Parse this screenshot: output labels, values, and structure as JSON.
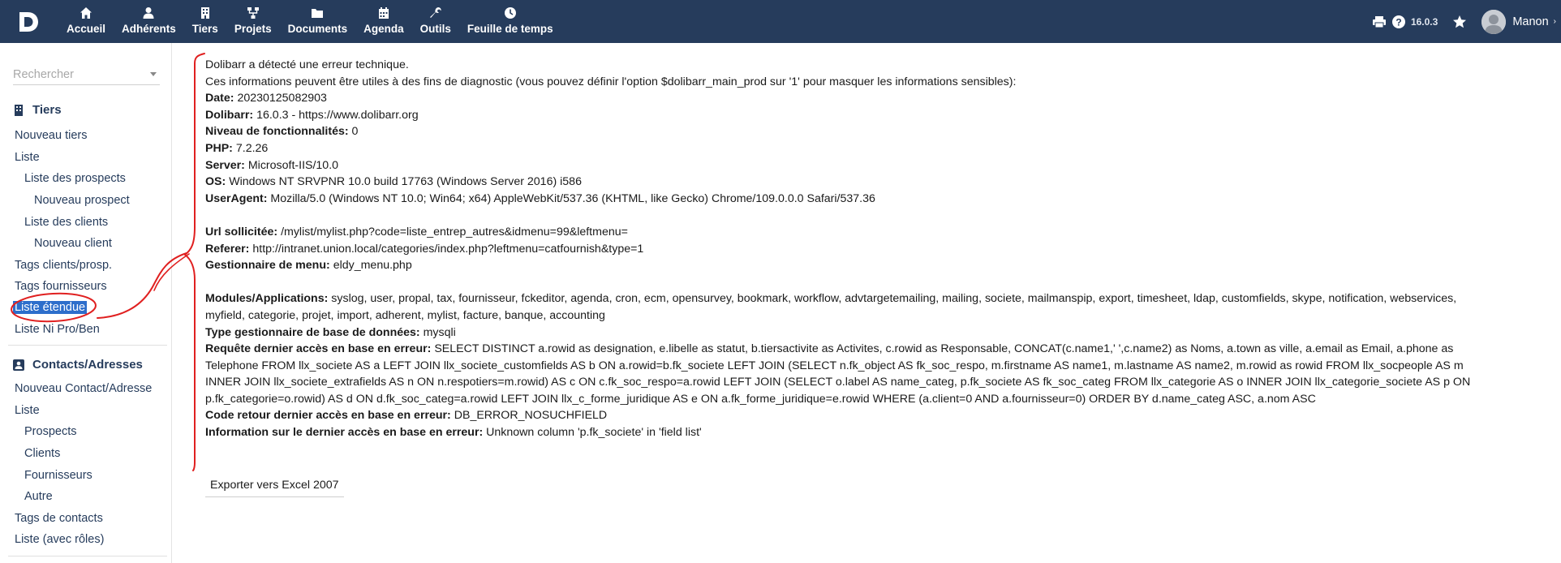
{
  "topbar": {
    "nav": [
      {
        "label": "Accueil",
        "icon": "home-icon"
      },
      {
        "label": "Adhérents",
        "icon": "user-icon"
      },
      {
        "label": "Tiers",
        "icon": "building-icon"
      },
      {
        "label": "Projets",
        "icon": "sitemap-icon"
      },
      {
        "label": "Documents",
        "icon": "folder-icon"
      },
      {
        "label": "Agenda",
        "icon": "calendar-icon"
      },
      {
        "label": "Outils",
        "icon": "wrench-icon"
      },
      {
        "label": "Feuille de temps",
        "icon": "timesheet-icon"
      }
    ],
    "active": "Tiers",
    "version": "16.0.3",
    "username": "Manon",
    "bar_color": "#263c5c"
  },
  "sidebar": {
    "search_placeholder": "Rechercher",
    "tiers_title": "Tiers",
    "tiers_items": [
      {
        "label": "Nouveau tiers"
      },
      {
        "label": "Liste"
      },
      {
        "label": "Liste des prospects"
      },
      {
        "label": "Nouveau prospect"
      },
      {
        "label": "Liste des clients"
      },
      {
        "label": "Nouveau client"
      },
      {
        "label": "Tags clients/prosp."
      },
      {
        "label": "Tags fournisseurs"
      },
      {
        "label": "Liste étendue"
      },
      {
        "label": "Liste Ni Pro/Ben"
      }
    ],
    "contacts_title": "Contacts/Adresses",
    "contacts_items": [
      {
        "label": "Nouveau Contact/Adresse"
      },
      {
        "label": "Liste"
      },
      {
        "label": "Prospects"
      },
      {
        "label": "Clients"
      },
      {
        "label": "Fournisseurs"
      },
      {
        "label": "Autre"
      },
      {
        "label": "Tags de contacts"
      },
      {
        "label": "Liste (avec rôles)"
      }
    ],
    "selected_color": "#2d6ecb"
  },
  "error": {
    "intro1": "Dolibarr a détecté une erreur technique.",
    "intro2": "Ces informations peuvent être utiles à des fins de diagnostic (vous pouvez définir l'option $dolibarr_main_prod sur '1' pour masquer les informations sensibles):",
    "date_label": "Date:",
    "date_value": "20230125082903",
    "dolibarr_label": "Dolibarr:",
    "dolibarr_value": "16.0.3 - https://www.dolibarr.org",
    "level_label": "Niveau de fonctionnalités:",
    "level_value": "0",
    "php_label": "PHP:",
    "php_value": "7.2.26",
    "server_label": "Server:",
    "server_value": "Microsoft-IIS/10.0",
    "os_label": "OS:",
    "os_value": "Windows NT SRVPNR 10.0 build 17763 (Windows Server 2016) i586",
    "ua_label": "UserAgent:",
    "ua_value": "Mozilla/5.0 (Windows NT 10.0; Win64; x64) AppleWebKit/537.36 (KHTML, like Gecko) Chrome/109.0.0.0 Safari/537.36",
    "url_label": "Url sollicitée:",
    "url_value": "/mylist/mylist.php?code=liste_entrep_autres&idmenu=99&leftmenu=",
    "referer_label": "Referer:",
    "referer_value": "http://intranet.union.local/categories/index.php?leftmenu=catfournish&type=1",
    "menu_label": "Gestionnaire de menu:",
    "menu_value": "eldy_menu.php",
    "modules_label": "Modules/Applications:",
    "modules_line1": "syslog, user, propal, tax, fournisseur, fckeditor, agenda, cron, ecm, opensurvey, bookmark, workflow, advtargetemailing, mailing, societe, mailmanspip, export, timesheet, ldap, customfields, skype, notification, webservices,",
    "modules_line2": "myfield, categorie, projet, import, adherent, mylist, facture, banque, accounting",
    "dbtype_label": "Type gestionnaire de base de données:",
    "dbtype_value": "mysqli",
    "request_label": "Requête dernier accès en base en erreur:",
    "request_line1": "SELECT DISTINCT a.rowid as designation, e.libelle as statut, b.tiersactivite as Activites, c.rowid as Responsable, CONCAT(c.name1,' ',c.name2) as Noms, a.town as ville, a.email as Email, a.phone as",
    "request_line2": "Telephone FROM llx_societe AS a LEFT JOIN llx_societe_customfields AS b ON a.rowid=b.fk_societe LEFT JOIN (SELECT n.fk_object AS fk_soc_respo, m.firstname AS name1, m.lastname AS name2, m.rowid as rowid FROM llx_socpeople AS m",
    "request_line3": "INNER JOIN llx_societe_extrafields AS n ON n.respotiers=m.rowid) AS c ON c.fk_soc_respo=a.rowid LEFT JOIN (SELECT o.label AS name_categ, p.fk_societe AS fk_soc_categ FROM llx_categorie AS o INNER JOIN llx_categorie_societe AS p ON",
    "request_line4": "p.fk_categorie=o.rowid) AS d ON d.fk_soc_categ=a.rowid LEFT JOIN llx_c_forme_juridique AS e ON a.fk_forme_juridique=e.rowid WHERE (a.client=0 AND a.fournisseur=0) ORDER BY d.name_categ ASC, a.nom ASC",
    "code_label": "Code retour dernier accès en base en erreur:",
    "code_value": "DB_ERROR_NOSUCHFIELD",
    "info_label": "Information sur le dernier accès en base en erreur:",
    "info_value": "Unknown column 'p.fk_societe' in 'field list'"
  },
  "export_label": "Exporter vers Excel 2007",
  "annotation_color": "#e02020"
}
